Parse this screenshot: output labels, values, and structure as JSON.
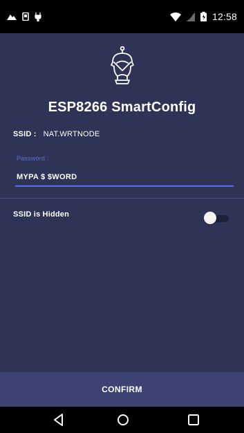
{
  "status_bar": {
    "time": "12:58",
    "icons": [
      "mountain-icon",
      "sim-card-icon",
      "usb-icon",
      "wifi-icon",
      "signal-icon",
      "battery-icon"
    ]
  },
  "app": {
    "logo_icon": "robot-icon",
    "title": "ESP8266 SmartConfig"
  },
  "ssid": {
    "label": "SSID :",
    "value": "NAT.WRTNODE"
  },
  "password": {
    "label": "Password :",
    "value": "MYPA $ $WORD"
  },
  "hidden_toggle": {
    "label": "SSID is Hidden",
    "state": "off"
  },
  "confirm": {
    "label": "CONFIRM"
  },
  "nav_bar": {
    "icons": [
      "back-icon",
      "home-icon",
      "recent-apps-icon"
    ]
  },
  "colors": {
    "background": "#2f3457",
    "confirm_bar": "#3c4272",
    "accent": "#5a6cf0",
    "password_label": "#5d6de3"
  }
}
